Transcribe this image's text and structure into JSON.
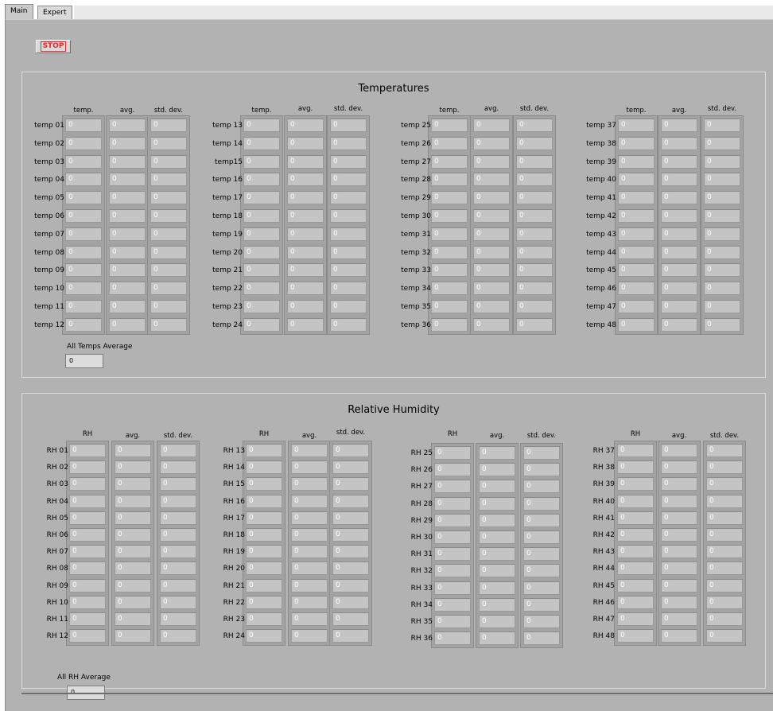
{
  "tabs": [
    {
      "label": "Main",
      "active": true
    },
    {
      "label": "Expert",
      "active": false
    }
  ],
  "stop_button": {
    "label": "STOP"
  },
  "temperatures": {
    "title": "Temperatures",
    "headers": [
      [
        "temp.",
        "avg.",
        "std. dev."
      ],
      [
        "temp.",
        "avg.",
        "std. dev."
      ],
      [
        "temp.",
        "avg.",
        "std. dev."
      ],
      [
        "temp.",
        "avg.",
        "std. dev."
      ]
    ],
    "rows": [
      [
        "temp 01",
        "temp 02",
        "temp 03",
        "temp 04",
        "temp 05",
        "temp 06",
        "temp 07",
        "temp 08",
        "temp 09",
        "temp 10",
        "temp 11",
        "temp 12"
      ],
      [
        "temp 13",
        "temp 14",
        "temp15",
        "temp 16",
        "temp 17",
        "temp 18",
        "temp 19",
        "temp 20",
        "temp 21",
        "temp 22",
        "temp 23",
        "temp 24"
      ],
      [
        "temp 25",
        "temp 26",
        "temp 27",
        "temp 28",
        "temp 29",
        "temp 30",
        "temp 31",
        "temp 32",
        "temp 33",
        "temp 34",
        "temp 35",
        "temp 36"
      ],
      [
        "temp 37",
        "temp 38",
        "temp 39",
        "temp 40",
        "temp 41",
        "temp 42",
        "temp 43",
        "temp 44",
        "temp 45",
        "temp 46",
        "temp 47",
        "temp 48"
      ]
    ],
    "value": "0",
    "average_label": "All Temps Average",
    "average_value": "0"
  },
  "humidity": {
    "title": "Relative Humidity",
    "headers": [
      [
        "RH",
        "avg.",
        "std. dev."
      ],
      [
        "RH",
        "avg.",
        "std. dev."
      ],
      [
        "RH",
        "avg.",
        "std. dev."
      ],
      [
        "RH",
        "avg.",
        "std. dev."
      ]
    ],
    "rows": [
      [
        "RH 01",
        "RH 02",
        "RH 03",
        "RH 04",
        "RH 05",
        "RH 06",
        "RH 07",
        "RH 08",
        "RH 09",
        "RH 10",
        "RH 11",
        "RH 12"
      ],
      [
        "RH 13",
        "RH 14",
        "RH 15",
        "RH 16",
        "RH 17",
        "RH 18",
        "RH 19",
        "RH 20",
        "RH 21",
        "RH 22",
        "RH 23",
        "RH 24"
      ],
      [
        "RH 25",
        "RH 26",
        "RH 27",
        "RH 28",
        "RH 29",
        "RH 30",
        "RH 31",
        "RH 32",
        "RH 33",
        "RH 34",
        "RH 35",
        "RH 36"
      ],
      [
        "RH 37",
        "RH 38",
        "RH 39",
        "RH 40",
        "RH 41",
        "RH 42",
        "RH 43",
        "RH 44",
        "RH 45",
        "RH 46",
        "RH 47",
        "RH 48"
      ]
    ],
    "value": "0",
    "average_label": "All RH Average",
    "average_value": "0"
  },
  "colors": {
    "panel_bg": "#b2b2b2",
    "field_bg": "#c4c4c4",
    "stop_text": "#e8262a"
  }
}
